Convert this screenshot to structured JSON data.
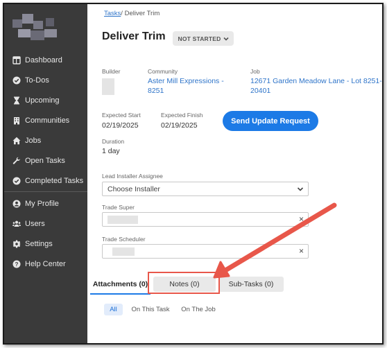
{
  "sidebar": {
    "items": [
      {
        "label": "Dashboard",
        "icon": "dashboard-icon"
      },
      {
        "label": "To-Dos",
        "icon": "check-circle-icon"
      },
      {
        "label": "Upcoming",
        "icon": "hourglass-icon"
      },
      {
        "label": "Communities",
        "icon": "building-icon"
      },
      {
        "label": "Jobs",
        "icon": "home-icon"
      },
      {
        "label": "Open Tasks",
        "icon": "wrench-icon"
      },
      {
        "label": "Completed Tasks",
        "icon": "check-circle-icon"
      },
      {
        "label": "My Profile",
        "icon": "user-circle-icon"
      },
      {
        "label": "Users",
        "icon": "users-icon"
      },
      {
        "label": "Settings",
        "icon": "gear-icon"
      },
      {
        "label": "Help Center",
        "icon": "question-circle-icon"
      }
    ]
  },
  "breadcrumb": {
    "root": "Tasks",
    "separator": "/",
    "current": "Deliver Trim"
  },
  "task": {
    "title": "Deliver Trim",
    "status": "NOT STARTED",
    "builder_label": "Builder",
    "community_label": "Community",
    "community_value": "Aster Mill Expressions - 8251",
    "job_label": "Job",
    "job_value": "12671 Garden Meadow Lane - Lot 8251-20401",
    "expected_start_label": "Expected Start",
    "expected_start": "02/19/2025",
    "expected_finish_label": "Expected Finish",
    "expected_finish": "02/19/2025",
    "duration_label": "Duration",
    "duration": "1 day",
    "send_update_label": "Send Update Request"
  },
  "assignees": {
    "lead_installer_label": "Lead Installer Assignee",
    "lead_installer_value": "Choose Installer",
    "trade_super_label": "Trade Super",
    "trade_scheduler_label": "Trade Scheduler",
    "clear_glyph": "×"
  },
  "tabs": [
    {
      "label": "Attachments (0)",
      "active": true
    },
    {
      "label": "Notes (0)",
      "active": false
    },
    {
      "label": "Sub-Tasks (0)",
      "active": false
    }
  ],
  "filters": [
    {
      "label": "All",
      "selected": true
    },
    {
      "label": "On This Task",
      "selected": false
    },
    {
      "label": "On The Job",
      "selected": false
    }
  ],
  "colors": {
    "sidebar_bg": "#3a3a3a",
    "accent": "#1c7ae6",
    "annotation": "#e8574a"
  }
}
